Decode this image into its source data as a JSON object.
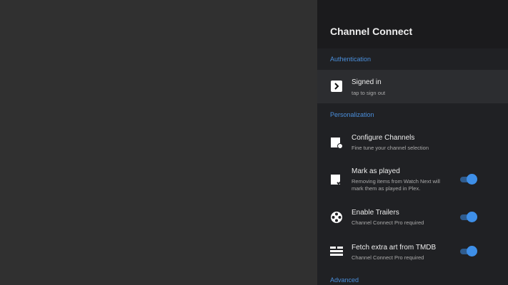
{
  "header": {
    "title": "Channel Connect"
  },
  "sections": {
    "authentication": "Authentication",
    "personalization": "Personalization",
    "advanced": "Advanced"
  },
  "items": [
    {
      "title": "Signed in",
      "subtitle": "tap to sign out",
      "icon": "plex-icon"
    },
    {
      "title": "Configure Channels",
      "subtitle": "Fine tune your channel selection",
      "icon": "clapperboard-settings-icon"
    },
    {
      "title": "Mark as played",
      "subtitle": "Removing items from Watch Next will mark them as played in Plex.",
      "icon": "clapperboard-check-icon",
      "toggle": true
    },
    {
      "title": "Enable Trailers",
      "subtitle": "Channel Connect Pro required",
      "icon": "film-reel-icon",
      "toggle": true
    },
    {
      "title": "Fetch extra art from TMDB",
      "subtitle": "Channel Connect Pro required",
      "icon": "tmdb-icon",
      "toggle": true
    }
  ],
  "colors": {
    "accent": "#3e8fe8",
    "section": "#4a8fdc",
    "panel": "#202124",
    "background": "#303030"
  }
}
